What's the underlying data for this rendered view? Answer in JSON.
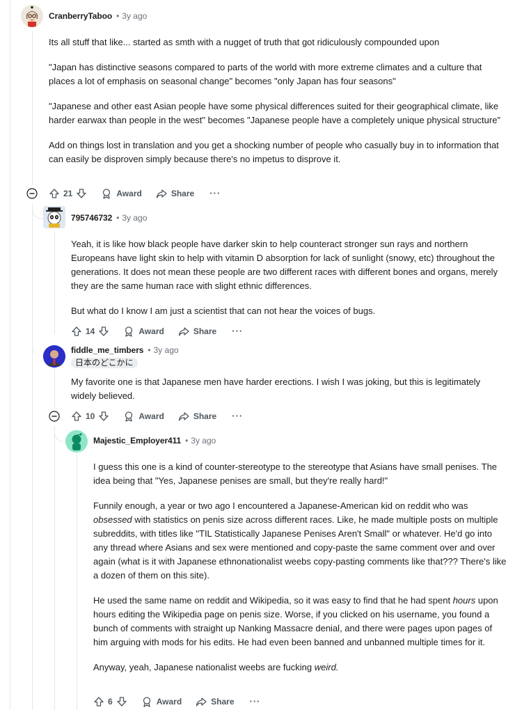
{
  "comments": [
    {
      "author": "CranberryTaboo",
      "age": "3y ago",
      "paragraphs": [
        "Its all stuff that like... started as smth with a nugget of truth that got ridiculously compounded upon",
        "\"Japan has distinctive seasons compared to parts of the world with more extreme climates and a culture that places a lot of emphasis on seasonal change\" becomes \"only Japan has four seasons\"",
        "\"Japanese and other east Asian people have some physical differences suited for their geographical climate, like harder earwax than people in the west\" becomes \"Japanese people have a completely unique physical structure\"",
        "Add on things lost in translation and you get a shocking number of people who casually buy in to information that can easily be disproven simply because there's no impetus to disprove it."
      ],
      "votes": "21",
      "award_label": "Award",
      "share_label": "Share",
      "more_label": "···"
    },
    {
      "author": "795746732",
      "age": "3y ago",
      "paragraphs": [
        "Yeah, it is like how black people have darker skin to help counteract stronger sun rays and northern Europeans have light skin to help with vitamin D absorption for lack of sunlight (snowy, etc) throughout the generations. It does not mean these people are two different races with different bones and organs, merely they are the same human race with slight ethnic differences.",
        "But what do I know I am just a scientist that can not hear the voices of bugs."
      ],
      "votes": "14",
      "award_label": "Award",
      "share_label": "Share",
      "more_label": "···"
    },
    {
      "author": "fiddle_me_timbers",
      "age": "3y ago",
      "flair": "日本のどこかに",
      "paragraphs": [
        "My favorite one is that Japanese men have harder erections. I wish I was joking, but this is legitimately widely believed."
      ],
      "votes": "10",
      "award_label": "Award",
      "share_label": "Share",
      "more_label": "···"
    },
    {
      "author": "Majestic_Employer411",
      "age": "3y ago",
      "p1": "I guess this one is a kind of counter-stereotype to the stereotype that Asians have small penises. The idea being that \"Yes, Japanese penises are small, but they're really hard!\"",
      "p2_a": "Funnily enough, a year or two ago I encountered a Japanese-American kid on reddit who was ",
      "p2_em": "obsessed",
      "p2_b": " with statistics on penis size across different races. Like, he made multiple posts on multiple subreddits, with titles like \"TIL Statistically Japanese Penises Aren't Small\" or whatever. He'd go into any thread where Asians and sex were mentioned and copy-paste the same comment over and over again (what is it with Japanese ethnonationalist weebs copy-pasting comments like that??? There's like a dozen of them on this site).",
      "p3_a": "He used the same name on reddit and Wikipedia, so it was easy to find that he had spent ",
      "p3_em": "hours",
      "p3_b": " upon hours editing the Wikipedia page on penis size. Worse, if you clicked on his username, you found a bunch of comments with straight up Nanking Massacre denial, and there were pages upon pages of him arguing with mods for his edits. He had even been banned and unbanned multiple times for it.",
      "p4_a": "Anyway, yeah, Japanese nationalist weebs are fucking ",
      "p4_em": "weird.",
      "votes": "6",
      "award_label": "Award",
      "share_label": "Share",
      "more_label": "···"
    }
  ]
}
